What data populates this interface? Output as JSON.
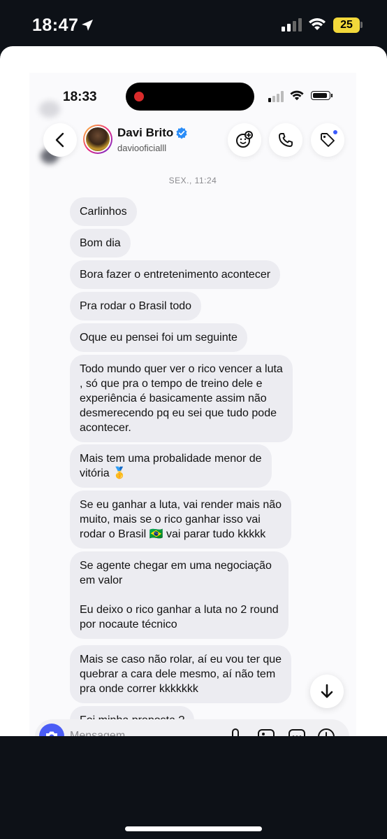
{
  "outer_status": {
    "time": "18:47",
    "battery": "25"
  },
  "inner_status": {
    "time": "18:33"
  },
  "header": {
    "name": "Davi Brito",
    "handle": "daviooficialll"
  },
  "date_label": "SEX., 11:24",
  "messages": [
    "Carlinhos",
    "Bom dia",
    "Bora fazer o entretenimento acontecer",
    "Pra rodar o Brasil todo",
    "Oque eu pensei foi um seguinte",
    "Todo mundo quer ver o rico vencer a luta\n, só que pra o tempo de treino dele e\nexperiência é basicamente assim não\ndesmerecendo pq eu sei que tudo pode\nacontecer.",
    "Mais tem uma probalidade menor de\nvitória 🥇",
    "Se eu ganhar a luta, vai render mais não\nmuito, mais se o rico ganhar isso vai\nrodar o Brasil 🇧🇷 vai parar tudo kkkkk",
    "Se agente chegar em uma negociação\nem valor\n\nEu deixo o rico ganhar a luta no 2 round\npor nocaute técnico",
    "Mais se caso não rolar, aí eu vou ter que\nquebrar a cara dele mesmo, aí não tem\npra onde correr kkkkkkk",
    "Foi minha proposta ?"
  ],
  "composer": {
    "placeholder": "Mensagem"
  },
  "colors": {
    "bubble": "#ececf1",
    "accent": "#4a5cf5",
    "verified": "#2a8cf7"
  },
  "icons": [
    "back-icon",
    "verified-icon",
    "add-friend-icon",
    "phone-icon",
    "tag-icon",
    "arrow-down-icon",
    "camera-icon",
    "mic-icon",
    "image-icon",
    "sticker-icon",
    "plus-icon"
  ]
}
